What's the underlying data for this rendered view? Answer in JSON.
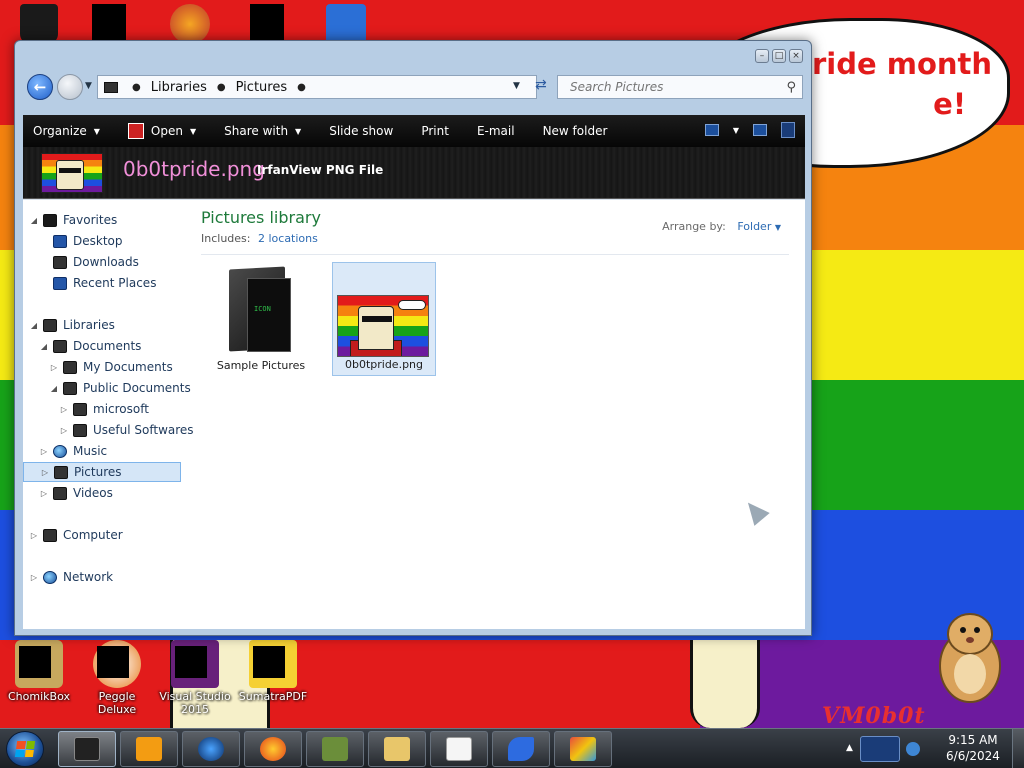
{
  "wallpaper": {
    "bubble_text": "ride month\n            e!",
    "watermark": "VM0b0t"
  },
  "desktop_icons": [
    {
      "label": "ChomikBox"
    },
    {
      "label": "Peggle Deluxe"
    },
    {
      "label": "Visual Studio 2015"
    },
    {
      "label": "SumatraPDF"
    }
  ],
  "window": {
    "nav": {
      "breadcrumbs": [
        "Libraries",
        "Pictures"
      ],
      "search_placeholder": "Search Pictures"
    },
    "toolbar": {
      "organize": "Organize",
      "open": "Open",
      "share_with": "Share with",
      "slide_show": "Slide show",
      "print": "Print",
      "email": "E-mail",
      "new_folder": "New folder"
    },
    "preview": {
      "file_name": "0b0tpride.png",
      "file_type": "IrfanView PNG File"
    },
    "nav_tree": {
      "favorites": "Favorites",
      "desktop": "Desktop",
      "downloads": "Downloads",
      "recent_places": "Recent Places",
      "libraries": "Libraries",
      "documents": "Documents",
      "my_documents": "My Documents",
      "public_documents": "Public Documents",
      "microsoft": "microsoft",
      "useful_softwares": "Useful Softwares",
      "music": "Music",
      "pictures": "Pictures",
      "videos": "Videos",
      "computer": "Computer",
      "network": "Network"
    },
    "library": {
      "title": "Pictures library",
      "includes_label": "Includes:",
      "includes_link": "2 locations",
      "arrange_label": "Arrange by:",
      "arrange_value": "Folder"
    },
    "items": [
      {
        "label": "Sample Pictures",
        "kind": "folder",
        "selected": false
      },
      {
        "label": "0b0tpride.png",
        "kind": "image",
        "selected": true
      }
    ]
  },
  "taskbar": {
    "time": "9:15 AM",
    "date": "6/6/2024"
  },
  "colors": {
    "library_title": "#1e7a3b",
    "link": "#2d6bb3",
    "file_name": "#f08fd8",
    "selection": "#d5e6f7"
  }
}
